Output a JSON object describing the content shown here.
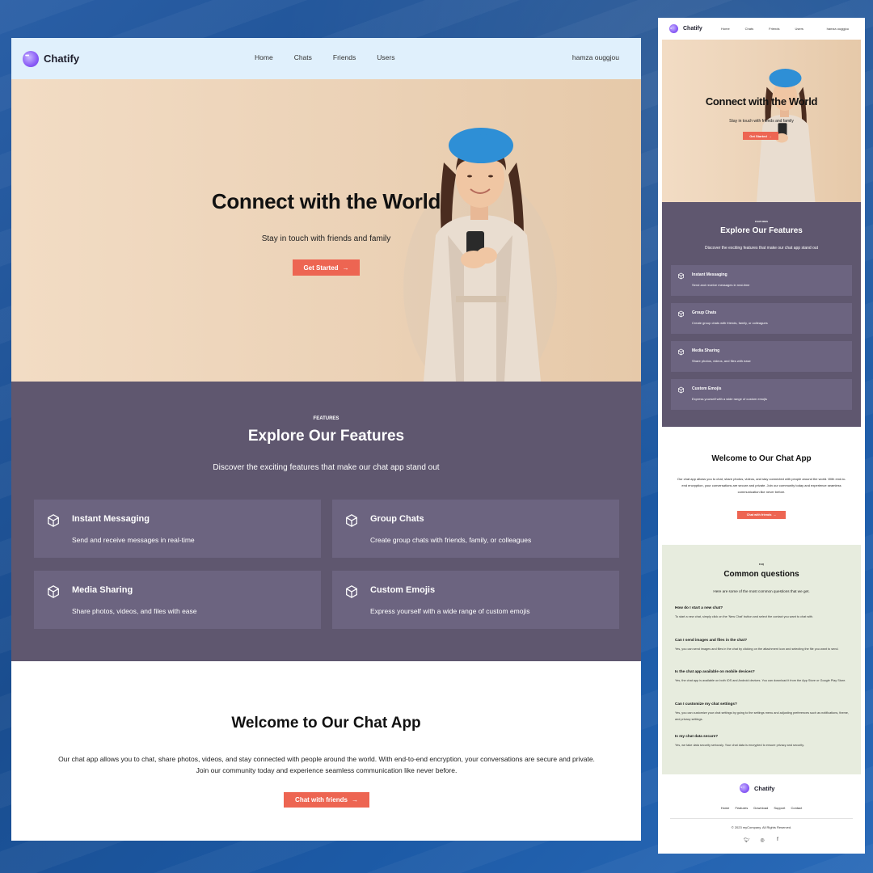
{
  "brand": {
    "name": "Chatify"
  },
  "nav": {
    "links": [
      "Home",
      "Chats",
      "Friends",
      "Users"
    ],
    "user": "hamza ouggjou"
  },
  "hero": {
    "title": "Connect with the World",
    "subtitle": "Stay in touch with friends and family",
    "cta": "Get Started",
    "cta_icon": "arrow-right-icon"
  },
  "features": {
    "eyebrow": "FEATURES",
    "title": "Explore Our Features",
    "subtitle": "Discover the exciting features that make our chat app stand out",
    "items": [
      {
        "title": "Instant Messaging",
        "desc": "Send and receive messages in real-time",
        "icon": "cube-icon"
      },
      {
        "title": "Group Chats",
        "desc": "Create group chats with friends, family, or colleagues",
        "icon": "cube-icon"
      },
      {
        "title": "Media Sharing",
        "desc": "Share photos, videos, and files with ease",
        "icon": "cube-icon"
      },
      {
        "title": "Custom Emojis",
        "desc": "Express yourself with a wide range of custom emojis",
        "icon": "cube-icon"
      }
    ]
  },
  "welcome": {
    "title": "Welcome to Our Chat App",
    "body": "Our chat app allows you to chat, share photos, videos, and stay connected with people around the world. With end-to-end encryption, your conversations are secure and private. Join our community today and experience seamless communication like never before.",
    "cta": "Chat with friends"
  },
  "faq": {
    "eyebrow": "FAQ",
    "title": "Common questions",
    "subtitle": "Here are some of the most common questions that we get.",
    "items": [
      {
        "q": "How do I start a new chat?",
        "a": "To start a new chat, simply click on the 'New Chat' button and select the contact you want to chat with."
      },
      {
        "q": "Can I send images and files in the chat?",
        "a": "Yes, you can send images and files in the chat by clicking on the attachment icon and selecting the file you want to send."
      },
      {
        "q": "Is the chat app available on mobile devices?",
        "a": "Yes, the chat app is available on both iOS and Android devices. You can download it from the App Store or Google Play Store."
      },
      {
        "q": "Can I customize my chat settings?",
        "a": "Yes, you can customize your chat settings by going to the settings menu and adjusting preferences such as notifications, theme, and privacy settings."
      },
      {
        "q": "Is my chat data secure?",
        "a": "Yes, we take data security seriously. Your chat data is encrypted to ensure privacy and security."
      }
    ]
  },
  "footer": {
    "links": [
      "Home",
      "Features",
      "Download",
      "Support",
      "Contact"
    ],
    "copyright": "© 2023 myCompany. All Rights Reserved.",
    "socials": [
      "twitter-icon",
      "instagram-icon",
      "facebook-icon"
    ]
  },
  "colors": {
    "nav_bg": "#e0f0fc",
    "features_bg": "#5f576f",
    "card_bg": "#6c6480",
    "accent": "#ed6552",
    "faq_bg": "#e7ecde",
    "backdrop": "#1a4d8f"
  }
}
